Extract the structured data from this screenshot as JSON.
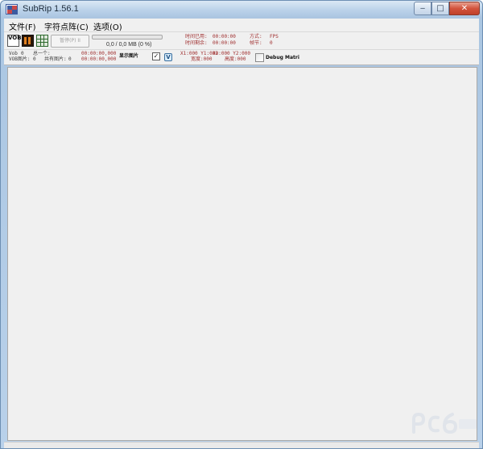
{
  "window": {
    "title": "SubRip 1.56.1"
  },
  "caption_buttons": {
    "minimize": "‒",
    "maximize": "□",
    "close": "✕"
  },
  "menu": [
    {
      "label": "文件(F)"
    },
    {
      "label": "字符点阵(C)"
    },
    {
      "label": "选项(O)"
    }
  ],
  "toolbar": {
    "vob_icon_text": "VOB",
    "pause_label": "暂停(P) II",
    "progress_percent": 0,
    "size_text": "0,0 / 0,0 MB (0 %)",
    "time_used_label": "时间已用:",
    "time_used_value": "00:00:00",
    "time_left_label": "时间剩余:",
    "time_left_value": "00:00:00",
    "mode_label": "方式:",
    "mode_value": "FPS",
    "frame_label": "帧节:",
    "frame_value": "0"
  },
  "info": {
    "vob_label": "Vob",
    "vob_value": "0",
    "vob_id_label": "VOB图片:",
    "vob_id_value": "0",
    "count_label": "总一个:",
    "shared_label": "共有图片:",
    "shared_value": "0",
    "time_start": "00:00:00,000",
    "time_end": "00:00:00,000",
    "show_image_label": "显示图片",
    "show_image_checked": "✓",
    "v_button": "V",
    "x1y1_label": "X1:000 Y1:000",
    "x2y2_label": "X2:000 Y2:000",
    "width_label": "宽度:000",
    "height_label": "高度:000",
    "debug_label": "Debug Matri"
  },
  "colors": {
    "accent": "#4ca64c",
    "close_button": "#d2533c",
    "label_red": "#a03030"
  },
  "icons": {
    "app": "subrip-app-icon",
    "vob": "vob-open-icon",
    "record": "record-icon",
    "grid": "char-matrix-icon"
  }
}
